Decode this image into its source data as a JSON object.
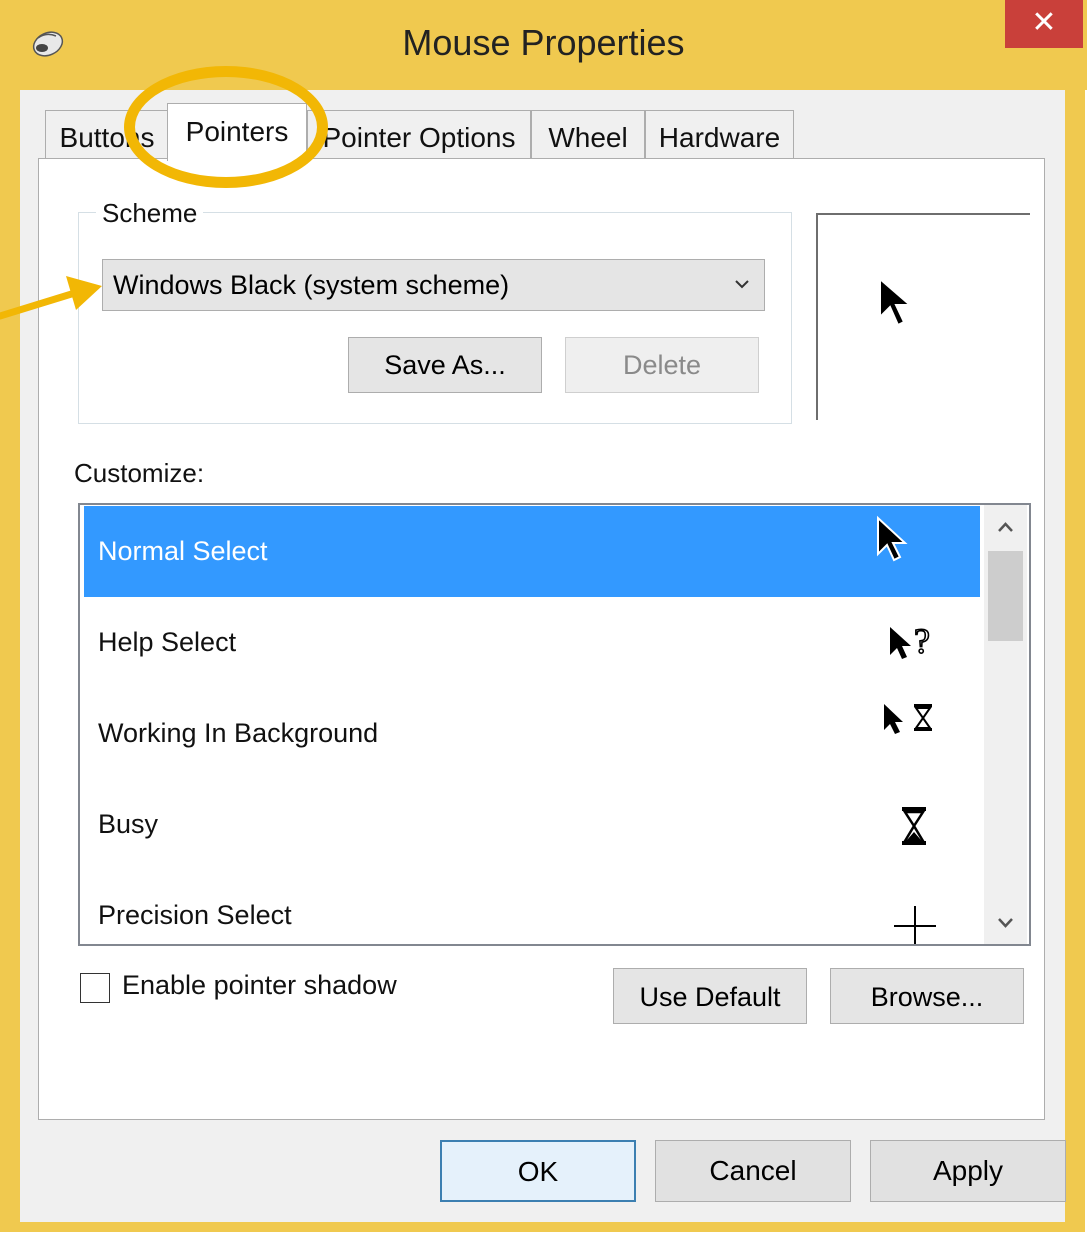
{
  "window": {
    "title": "Mouse Properties",
    "close_glyph": "✕",
    "accent_color": "#f0c94f",
    "close_color": "#c9403a"
  },
  "tabs": [
    {
      "label": "Buttons",
      "active": false
    },
    {
      "label": "Pointers",
      "active": true
    },
    {
      "label": "Pointer Options",
      "active": false
    },
    {
      "label": "Wheel",
      "active": false
    },
    {
      "label": "Hardware",
      "active": false
    }
  ],
  "scheme": {
    "group_label": "Scheme",
    "selected_value": "Windows Black (system scheme)",
    "save_as_label": "Save As...",
    "delete_label": "Delete"
  },
  "customize": {
    "label": "Customize:",
    "items": [
      {
        "label": "Normal Select",
        "icon": "arrow-cursor-icon",
        "selected": true
      },
      {
        "label": "Help Select",
        "icon": "help-cursor-icon",
        "selected": false
      },
      {
        "label": "Working In Background",
        "icon": "working-cursor-icon",
        "selected": false
      },
      {
        "label": "Busy",
        "icon": "hourglass-icon",
        "selected": false
      },
      {
        "label": "Precision Select",
        "icon": "crosshair-icon",
        "selected": false
      }
    ],
    "selection_color": "#3399ff"
  },
  "options": {
    "enable_shadow_label": "Enable pointer shadow",
    "enable_shadow_checked": false,
    "use_default_label": "Use Default",
    "browse_label": "Browse..."
  },
  "dialog_buttons": {
    "ok_label": "OK",
    "cancel_label": "Cancel",
    "apply_label": "Apply"
  },
  "annotations": {
    "highlight_color": "#f2b705"
  }
}
